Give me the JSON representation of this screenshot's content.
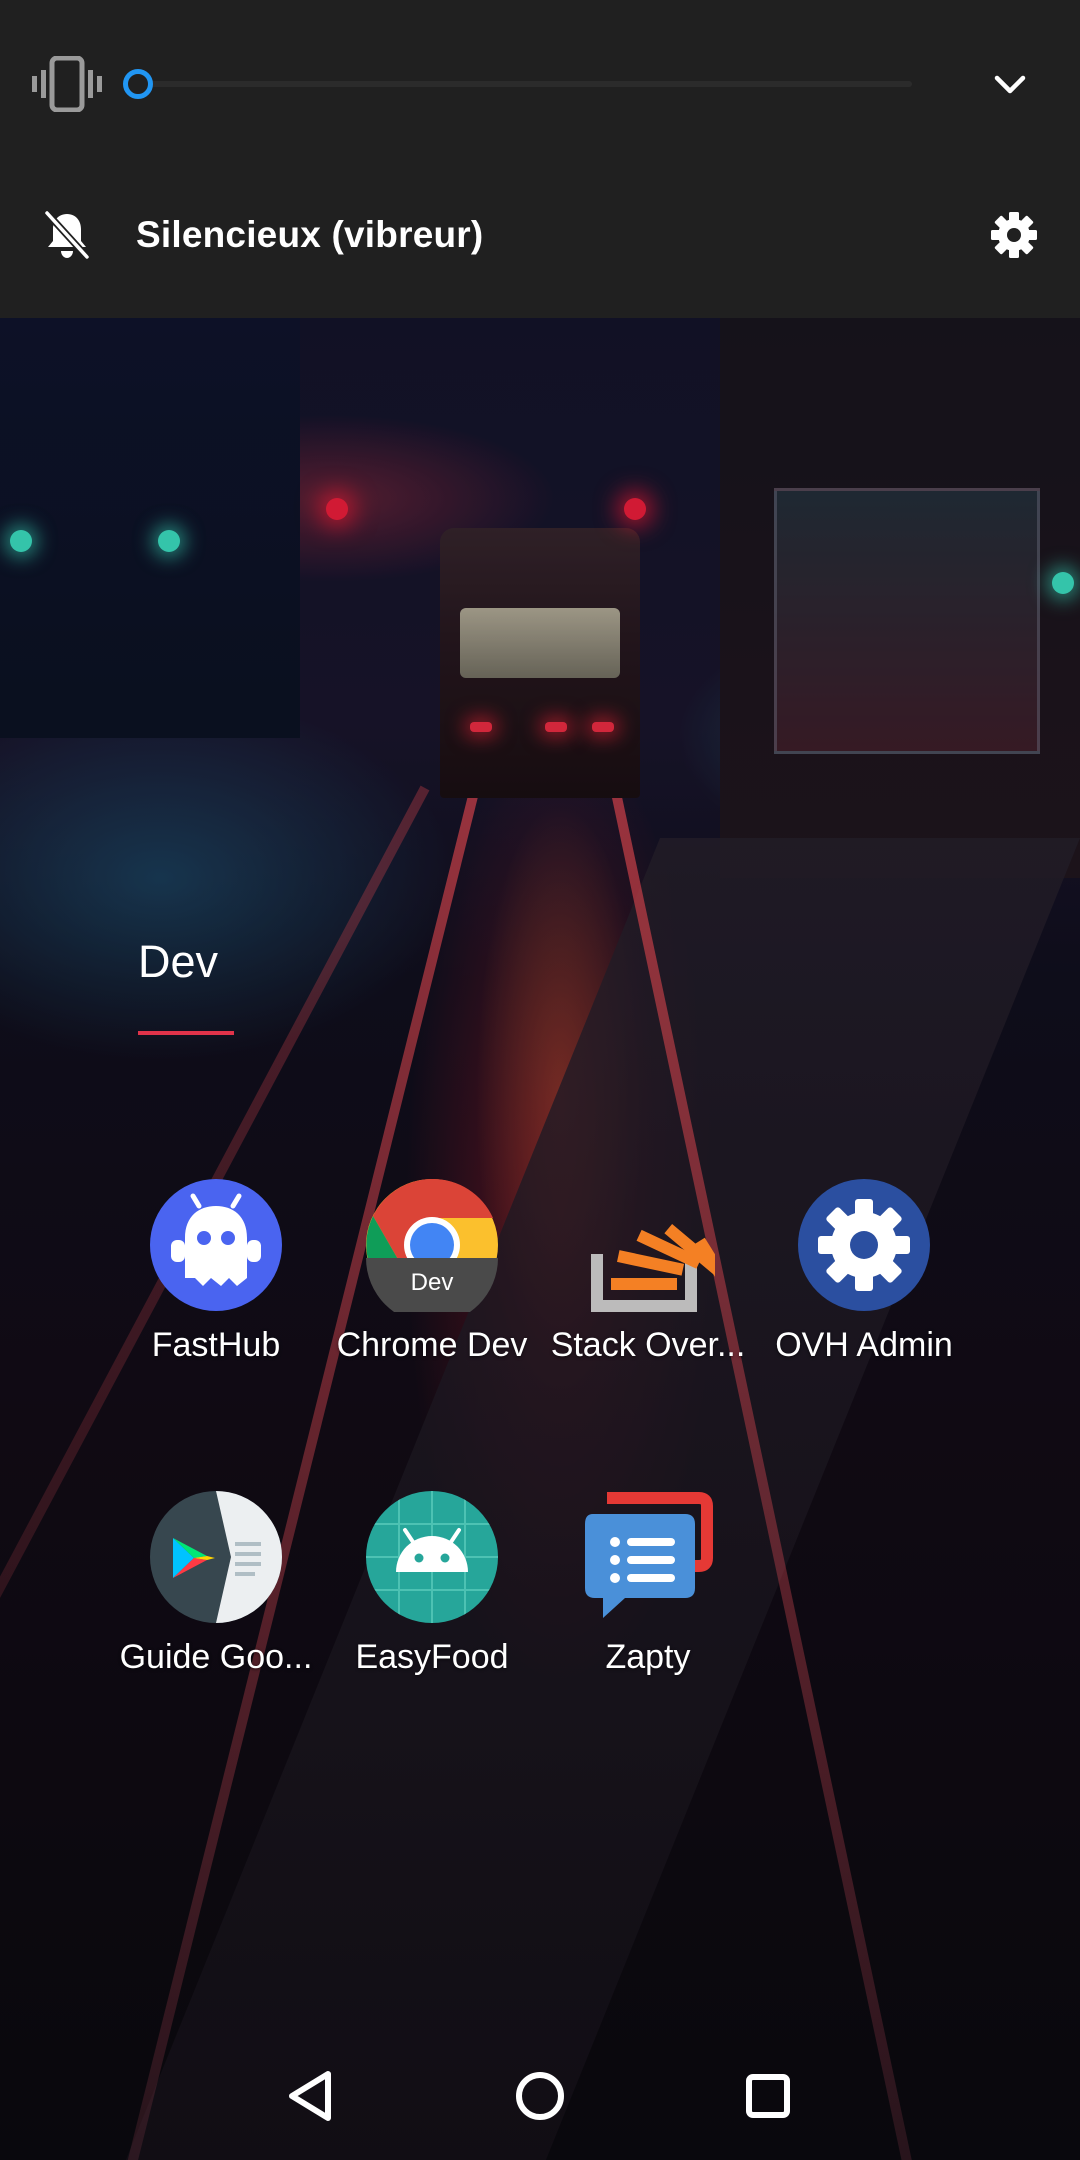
{
  "volume_panel": {
    "ringer_mode_label": "Silencieux (vibreur)",
    "ring_volume_level": 0.0,
    "accent_color": "#2196f3",
    "icons": [
      "vibrate-icon",
      "chevron-down-icon",
      "bell-off-icon",
      "gear-icon"
    ]
  },
  "folder": {
    "title": "Dev",
    "accent_color": "#e0334a",
    "apps": [
      {
        "label": "FastHub",
        "icon": "fasthub-icon"
      },
      {
        "label": "Chrome Dev",
        "icon": "chrome-dev-icon",
        "badge": "Dev"
      },
      {
        "label": "Stack Over...",
        "icon": "stack-overflow-icon"
      },
      {
        "label": "OVH Admin",
        "icon": "ovh-admin-icon"
      },
      {
        "label": "Guide Goo...",
        "icon": "play-guide-icon"
      },
      {
        "label": "EasyFood",
        "icon": "easyfood-icon"
      },
      {
        "label": "Zapty",
        "icon": "zapty-icon"
      }
    ]
  },
  "navigation_bar": {
    "buttons": [
      "back-icon",
      "home-icon",
      "recents-icon"
    ]
  }
}
